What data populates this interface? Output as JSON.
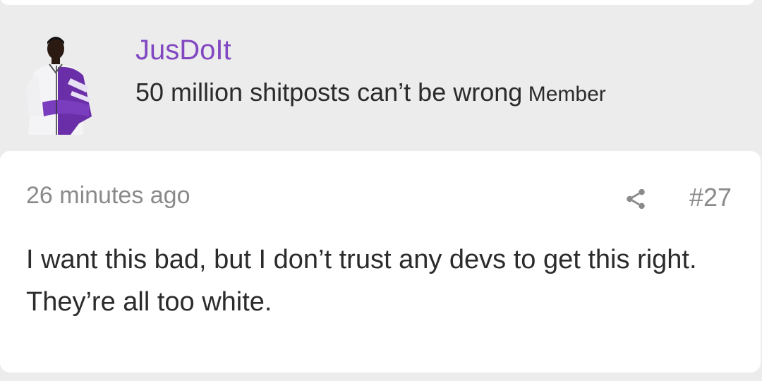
{
  "user": {
    "username": "JusDoIt",
    "title": "50 million shitposts can’t be wrong",
    "role": "Member",
    "avatar_icon": "user-avatar-photo"
  },
  "post": {
    "timestamp": "26 minutes ago",
    "number": "#27",
    "share_icon": "share-icon",
    "body": "I want this bad, but I don’t trust any devs to get this right. They’re all too white."
  },
  "colors": {
    "accent": "#8148c2",
    "background": "#ececec",
    "card": "#ffffff",
    "muted_text": "#8a8a8a",
    "body_text": "#2b2b2b"
  }
}
